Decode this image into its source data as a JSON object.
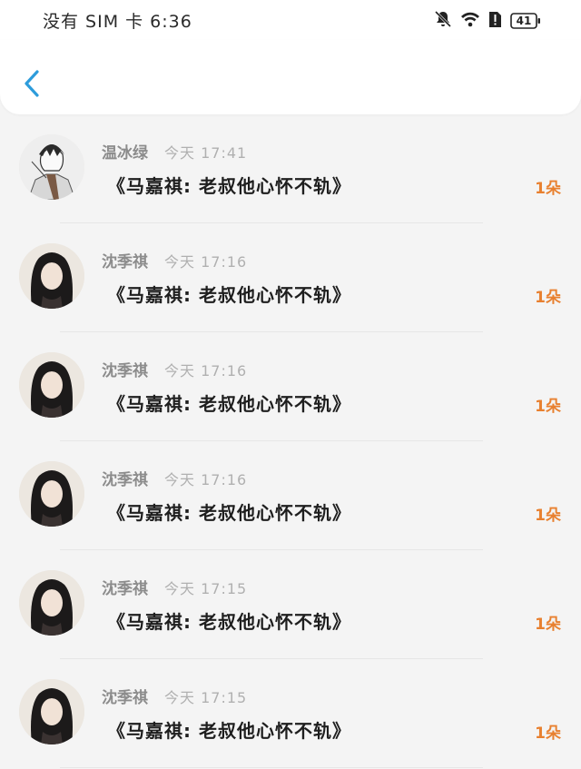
{
  "status_bar": {
    "text": "没有 SIM 卡 6:36",
    "battery": "41"
  },
  "header": {
    "back_icon": "chevron-left-icon",
    "accent_color": "#2d9cdb"
  },
  "items": [
    {
      "name": "温冰绿",
      "time": "今天 17:41",
      "title": "《马嘉祺:  老叔他心怀不轨》",
      "count": "1朵",
      "avatar": "sketch-avatar"
    },
    {
      "name": "沈季祺",
      "time": "今天 17:16",
      "title": "《马嘉祺:  老叔他心怀不轨》",
      "count": "1朵",
      "avatar": "photo-avatar"
    },
    {
      "name": "沈季祺",
      "time": "今天 17:16",
      "title": "《马嘉祺:  老叔他心怀不轨》",
      "count": "1朵",
      "avatar": "photo-avatar"
    },
    {
      "name": "沈季祺",
      "time": "今天 17:16",
      "title": "《马嘉祺:  老叔他心怀不轨》",
      "count": "1朵",
      "avatar": "photo-avatar"
    },
    {
      "name": "沈季祺",
      "time": "今天 17:15",
      "title": "《马嘉祺:  老叔他心怀不轨》",
      "count": "1朵",
      "avatar": "photo-avatar"
    },
    {
      "name": "沈季祺",
      "time": "今天 17:15",
      "title": "《马嘉祺:  老叔他心怀不轨》",
      "count": "1朵",
      "avatar": "photo-avatar"
    }
  ]
}
